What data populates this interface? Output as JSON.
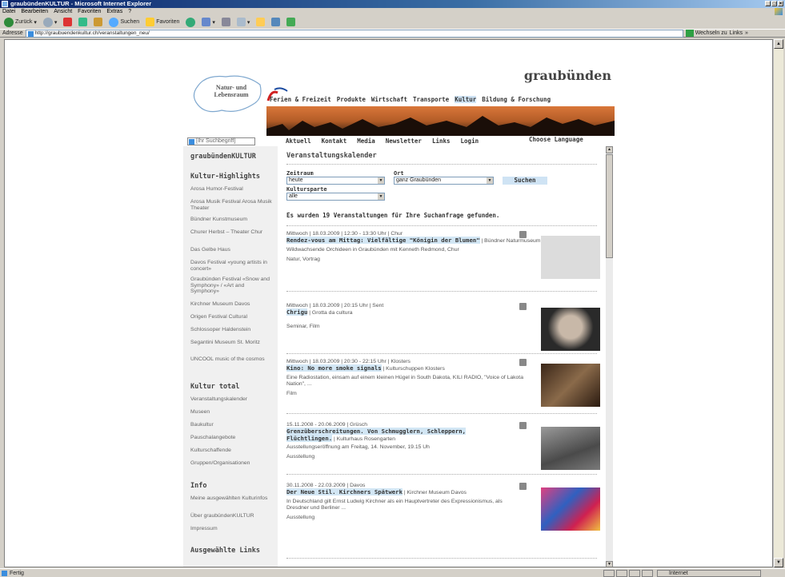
{
  "window": {
    "title": "graubündenKULTUR - Microsoft Internet Explorer"
  },
  "menu": [
    "Datei",
    "Bearbeiten",
    "Ansicht",
    "Favoriten",
    "Extras",
    "?"
  ],
  "toolbar": {
    "back": "Zurück",
    "search": "Suchen",
    "favorites": "Favoriten"
  },
  "address": {
    "label": "Adresse",
    "url": "http://graubuendenkultur.ch/veranstaltungen_neu/",
    "go": "Wechseln zu",
    "links": "Links"
  },
  "status": {
    "left": "Fertig",
    "zone": "Internet"
  },
  "site": {
    "map_text": "Natur- und Lebensraum",
    "brand": "graubünden",
    "nav_top": [
      "Ferien & Freizeit",
      "Produkte",
      "Wirtschaft",
      "Transporte",
      "Kultur",
      "Bildung & Forschung"
    ],
    "search_placeholder": "[Ihr Suchbegriff]",
    "nav_sub": [
      "Aktuell",
      "Kontakt",
      "Media",
      "Newsletter",
      "Links",
      "Login"
    ],
    "language": "Choose Language"
  },
  "sidebar": {
    "title": "graubündenKULTUR",
    "highlights_title": "Kultur-Highlights",
    "highlights": [
      "Arosa Humor-Festival",
      "Arosa Musik Festival Arosa Musik Theater",
      "Bündner Kunstmuseum",
      "Churer Herbst – Theater Chur",
      "Das Gelbe Haus",
      "Davos Festival «young artists in concert»",
      "Graubünden Festival «Snow and Symphony» / «Art and Symphony»",
      "Kirchner Museum Davos",
      "Origen Festival Cultural",
      "Schlossoper Haldenstein",
      "Segantini Museum St. Moritz",
      "UNCOOL music of the cosmos"
    ],
    "total_title": "Kultur total",
    "total": [
      "Veranstaltungskalender",
      "Museen",
      "Baukultur",
      "Pauschalangebote",
      "Kulturschaffende",
      "Gruppen/Organisationen"
    ],
    "info_title": "Info",
    "info": [
      "Meine ausgewählten Kulturinfos",
      "Über graubündenKULTUR",
      "Impressum"
    ],
    "links_title": "Ausgewählte Links"
  },
  "main": {
    "title": "Veranstaltungskalender",
    "zeitraum_label": "Zeitraum",
    "zeitraum_value": "heute",
    "ort_label": "Ort",
    "ort_value": "ganz Graubünden",
    "sparte_label": "Kultursparte",
    "sparte_value": "alle",
    "search_button": "Suchen",
    "result_msg": "Es wurden 19 Veranstaltungen für Ihre Suchanfrage gefunden.",
    "events": [
      {
        "meta": "Mittwoch | 18.03.2009 | 12:30 - 13:30 Uhr | Chur",
        "title": "Rendez-vous am Mittag: Vielfältige \"Königin der Blumen\"",
        "venue": " | Bündner Naturmuseum",
        "desc": "Wildwachsende Orchideen in Graubünden mit Kenneth Redmond, Chur",
        "cat": "Natur, Vortrag",
        "color": "#d8d8d8"
      },
      {
        "meta": "Mittwoch | 18.03.2009 | 20:15 Uhr | Sent",
        "title": "Chrigu",
        "venue": " | Grotta da cultura",
        "desc": "",
        "cat": "Seminar, Film",
        "color": "#6b6b6b"
      },
      {
        "meta": "Mittwoch | 18.03.2009 | 20:30 - 22:15 Uhr | Klosters",
        "title": "Kino: No more smoke signals",
        "venue": " | Kulturschuppen Klosters",
        "desc": "Eine Radiostation, einsam auf einem kleinen Hügel in South Dakota, KILI RADIO, \"Voice of Lakota Nation\", ...",
        "cat": "Film",
        "color": "#5a4030"
      },
      {
        "meta": "15.11.2008 - 20.06.2009 | Grüsch",
        "title": "Grenzüberschreitungen. Von Schmugglern, Schleppern, Flüchtlingen.",
        "venue": " | Kulturhaus Rosengarten",
        "desc": "Ausstellungseröffnung am Freitag, 14. November, 19.15 Uh",
        "cat": "Ausstellung",
        "color": "#7a7a7a"
      },
      {
        "meta": "30.11.2008 - 22.03.2009 | Davos",
        "title": "Der Neue Stil. Kirchners Spätwerk",
        "venue": " | Kirchner Museum Davos",
        "desc": "In Deutschland gilt Ernst Ludwig Kirchner als ein Hauptvertreter des Expressionismus, als Dresdner und Berliner ...",
        "cat": "Ausstellung",
        "color": "#c03060"
      }
    ]
  }
}
